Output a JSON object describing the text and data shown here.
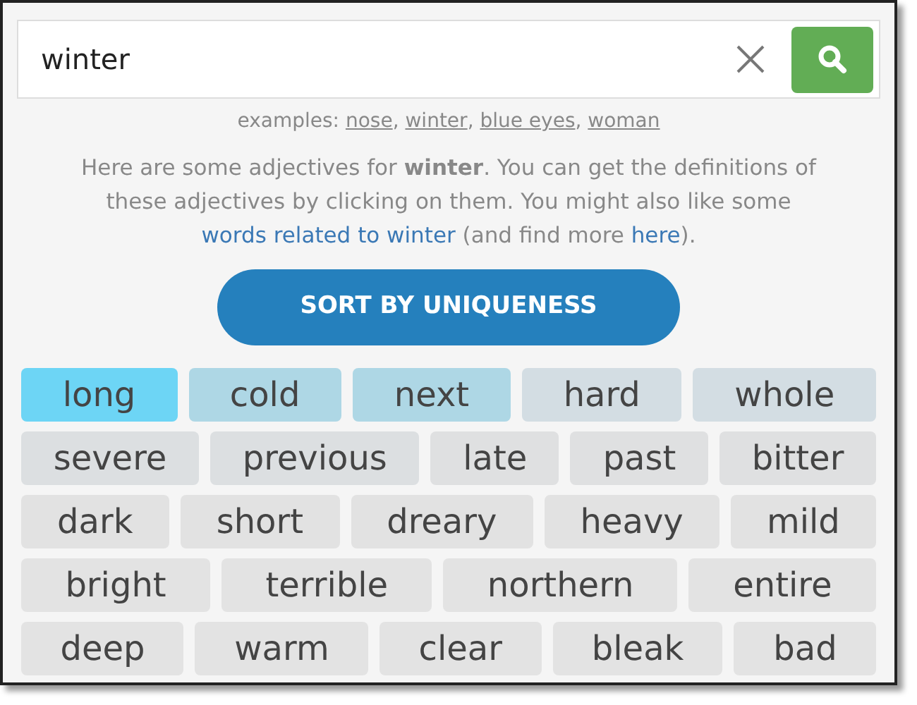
{
  "search": {
    "value": "winter"
  },
  "examples": {
    "label": "examples:",
    "separator": ",",
    "items": [
      "nose",
      "winter",
      "blue eyes",
      "woman"
    ]
  },
  "intro": {
    "text": "Here are some adjectives for **winter**. You can get the definitions of these adjectives by clicking on them. You might also like some ",
    "link": "words related to winter",
    "middle": " (and find more ",
    "link2": "here",
    "end": ")."
  },
  "sort_button": "SORT BY UNIQUENESS",
  "rows": [
    [
      {
        "word": "long",
        "color": "#6dd5f5"
      },
      {
        "word": "cold",
        "color": "#aed7e5"
      },
      {
        "word": "next",
        "color": "#aed7e5"
      },
      {
        "word": "hard",
        "color": "#d3dde3"
      },
      {
        "word": "whole",
        "color": "#d3dde3"
      }
    ],
    [
      {
        "word": "severe",
        "color": "#dcdfe1"
      },
      {
        "word": "previous",
        "color": "#dcdfe1"
      },
      {
        "word": "late",
        "color": "#dfe0e1"
      },
      {
        "word": "past",
        "color": "#dfe0e1"
      },
      {
        "word": "bitter",
        "color": "#dfe0e1"
      }
    ],
    [
      {
        "word": "dark",
        "color": "#e2e2e2"
      },
      {
        "word": "short",
        "color": "#e2e2e2"
      },
      {
        "word": "dreary",
        "color": "#e2e2e2"
      },
      {
        "word": "heavy",
        "color": "#e2e2e2"
      },
      {
        "word": "mild",
        "color": "#e2e2e2"
      }
    ],
    [
      {
        "word": "bright",
        "color": "#e3e3e3"
      },
      {
        "word": "terrible",
        "color": "#e3e3e3"
      },
      {
        "word": "northern",
        "color": "#e3e3e3"
      },
      {
        "word": "entire",
        "color": "#e3e3e3"
      }
    ],
    [
      {
        "word": "deep",
        "color": "#e3e3e3"
      },
      {
        "word": "warm",
        "color": "#e3e3e3"
      },
      {
        "word": "clear",
        "color": "#e3e3e3"
      },
      {
        "word": "bleak",
        "color": "#e3e3e3"
      },
      {
        "word": "bad",
        "color": "#e3e3e3"
      }
    ]
  ]
}
